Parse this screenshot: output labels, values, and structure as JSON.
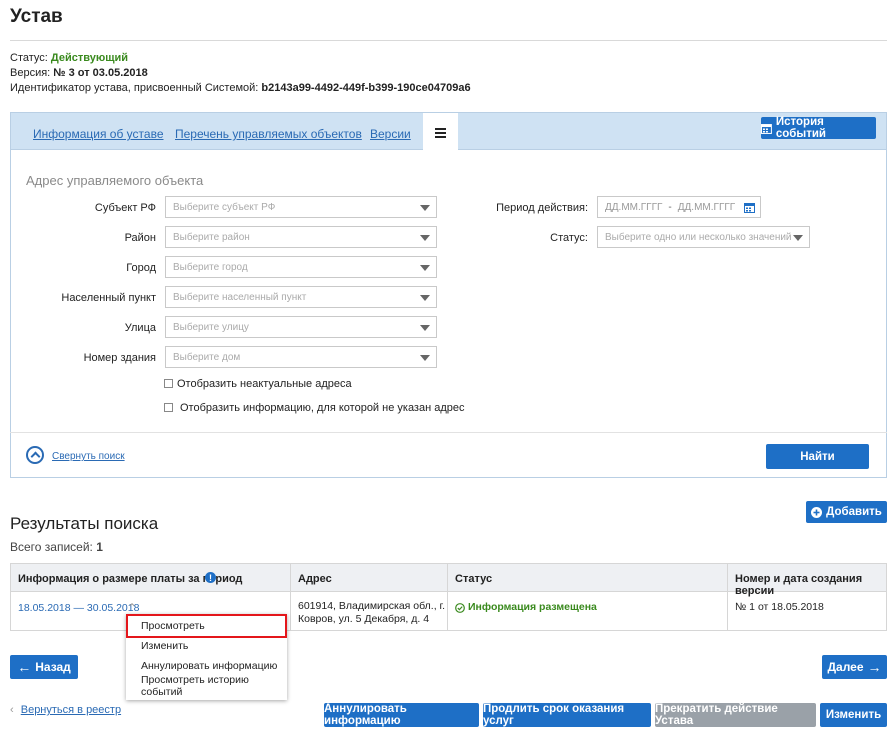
{
  "header": {
    "title": "Устав",
    "status_label": "Статус:",
    "status_value": "Действующий",
    "version_label": "Версия:",
    "version_value": "№ 3 от 03.05.2018",
    "id_label": "Идентификатор устава, присвоенный Системой:",
    "id_value": "b2143a99-4492-449f-b399-190ce04709a6"
  },
  "tabs": [
    {
      "label": "Информация об уставе"
    },
    {
      "label": "Перечень управляемых объектов"
    },
    {
      "label": "Версии"
    }
  ],
  "history_button": "История событий",
  "filter": {
    "section_title": "Адрес управляемого объекта",
    "fields": [
      {
        "label": "Субъект РФ",
        "placeholder": "Выберите субъект РФ"
      },
      {
        "label": "Район",
        "placeholder": "Выберите район"
      },
      {
        "label": "Город",
        "placeholder": "Выберите город"
      },
      {
        "label": "Населенный пункт",
        "placeholder": "Выберите населенный пункт"
      },
      {
        "label": "Улица",
        "placeholder": "Выберите улицу"
      },
      {
        "label": "Номер здания",
        "placeholder": "Выберите дом"
      }
    ],
    "period_label": "Период действия:",
    "period_from": "ДД.ММ.ГГГГ",
    "period_sep": "-",
    "period_to": "ДД.ММ.ГГГГ",
    "status_label": "Статус:",
    "status_placeholder": "Выберите одно или несколько значений",
    "checkbox1": "Отобразить неактуальные адреса",
    "checkbox2": "Отобразить информацию, для которой не указан адрес",
    "collapse_label": "Свернуть поиск",
    "find_button": "Найти"
  },
  "results": {
    "title": "Результаты поиска",
    "total_label": "Всего записей:",
    "total_value": "1",
    "add_button": "Добавить",
    "columns": [
      "Информация о размере платы за период",
      "Адрес",
      "Статус",
      "Номер и дата создания версии"
    ],
    "row": {
      "period": "18.05.2018 — 30.05.2018",
      "address_line1": "601914, Владимирская обл., г.",
      "address_line2": "Ковров, ул. 5 Декабря, д. 4",
      "status": "Информация размещена",
      "version": "№ 1 от 18.05.2018"
    },
    "menu": [
      "Просмотреть",
      "Изменить",
      "Аннулировать информацию",
      "Просмотреть историю событий"
    ]
  },
  "nav": {
    "back": "Назад",
    "next": "Далее",
    "return_link": "Вернуться в реестр"
  },
  "actions": {
    "annul": "Аннулировать информацию",
    "extend": "Продлить срок оказания услуг",
    "terminate": "Прекратить действие Устава",
    "edit": "Изменить"
  },
  "colors": {
    "primary": "#1e6fc6",
    "status_green": "#3a8a1e",
    "tabbar": "#cfe2f3",
    "highlight": "#e4161b",
    "disabled": "#9aa1a8"
  }
}
